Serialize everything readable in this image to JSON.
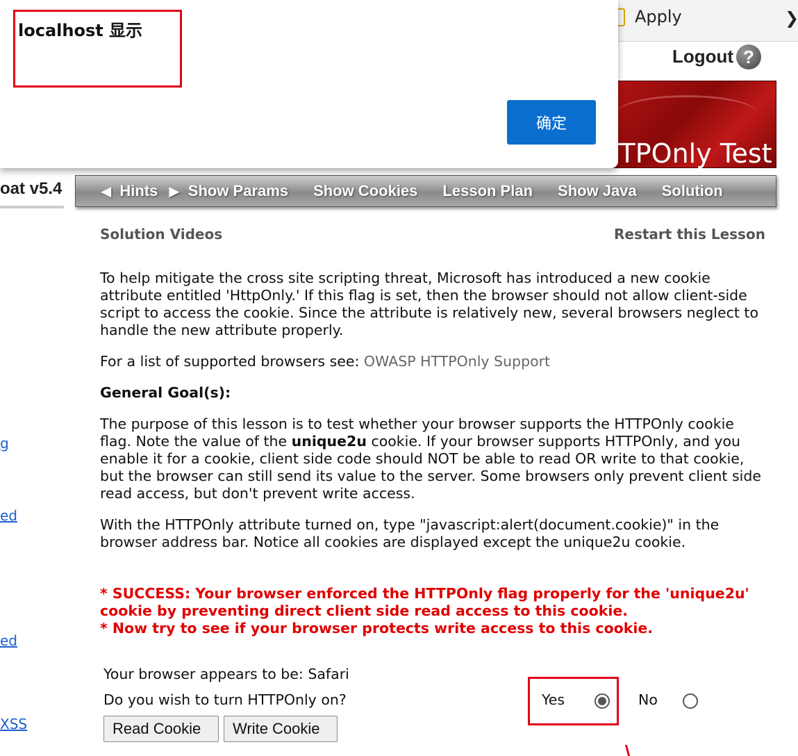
{
  "toolbar": {
    "apply_label": "Apply"
  },
  "header": {
    "logout_label": "Logout",
    "help_glyph": "?",
    "banner_title": "TTPOnly Test",
    "version": "oat  v5.4"
  },
  "menu": {
    "items": [
      "Hints",
      "Show Params",
      "Show Cookies",
      "Lesson Plan",
      "Show Java",
      "Solution"
    ]
  },
  "links": {
    "solution_videos": "Solution Videos",
    "restart": "Restart this Lesson"
  },
  "lesson": {
    "intro": "To help mitigate the cross site scripting threat, Microsoft has introduced a new cookie attribute entitled 'HttpOnly.' If this flag is set, then the browser should not allow client-side script to access the cookie. Since the attribute is relatively new, several browsers neglect to handle the new attribute properly.",
    "supported_prefix": "For a list of supported browsers see: ",
    "supported_link": "OWASP HTTPOnly Support",
    "goal_heading": "General Goal(s):",
    "purpose_part1": "The purpose of this lesson is to test whether your browser supports the HTTPOnly cookie flag. Note the value of the ",
    "purpose_bold": "unique2u",
    "purpose_part2": " cookie. If your browser supports HTTPOnly, and you enable it for a cookie, client side code should NOT be able to read OR write to that cookie, but the browser can still send its value to the server. Some browsers only prevent client side read access, but don't prevent write access.",
    "instruction": "With the HTTPOnly attribute turned on, type \"javascript:alert(document.cookie)\" in the browser address bar. Notice all cookies are displayed except the unique2u cookie."
  },
  "status": {
    "success_line1": "* SUCCESS: Your browser enforced the HTTPOnly flag properly for the 'unique2u' cookie by preventing direct client side read access to this cookie.",
    "success_line2": "* Now try to see if your browser protects write access to this cookie."
  },
  "form": {
    "browser_text": "Your browser appears to be: Safari",
    "question": "Do you wish to turn HTTPOnly on?",
    "yes_label": "Yes",
    "no_label": "No",
    "selected": "Yes",
    "read_button": "Read Cookie",
    "write_button": "Write Cookie"
  },
  "sidebar_fragments": [
    "g",
    "ed",
    "ed",
    "XSS"
  ],
  "dialog": {
    "title": "localhost 显示",
    "ok_label": "确定"
  },
  "colors": {
    "success_red": "#e00000",
    "dialog_button": "#0a6ecf",
    "annotation_red": "#e0001a"
  }
}
